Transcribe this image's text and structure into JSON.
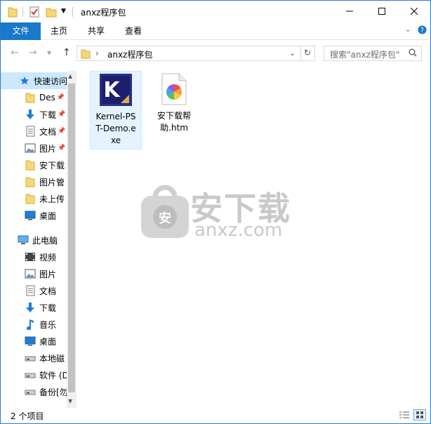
{
  "window": {
    "title": "anxz程序包",
    "colors": {
      "accent": "#1979ca",
      "selection": "#cce8ff",
      "border": "#2b79d6"
    }
  },
  "ribbon": {
    "tabs": [
      "文件",
      "主页",
      "共享",
      "查看"
    ]
  },
  "address": {
    "path": "anxz程序包",
    "search_placeholder": "搜索\"anxz程序包\""
  },
  "nav": {
    "quick_access": "快速访问",
    "quick_items": [
      {
        "label": "Des",
        "icon": "folder-icon",
        "pinned": true
      },
      {
        "label": "下载",
        "icon": "download-icon",
        "pinned": true
      },
      {
        "label": "文档",
        "icon": "document-icon",
        "pinned": true
      },
      {
        "label": "图片",
        "icon": "picture-icon",
        "pinned": true
      },
      {
        "label": "安下载",
        "icon": "folder-icon",
        "pinned": false
      },
      {
        "label": "图片管",
        "icon": "folder-icon",
        "pinned": false
      },
      {
        "label": "未上传",
        "icon": "folder-icon",
        "pinned": false
      },
      {
        "label": "桌面",
        "icon": "desktop-icon",
        "pinned": false
      }
    ],
    "this_pc": "此电脑",
    "pc_items": [
      {
        "label": "视频",
        "icon": "video-icon"
      },
      {
        "label": "图片",
        "icon": "picture-icon"
      },
      {
        "label": "文档",
        "icon": "document-icon"
      },
      {
        "label": "下载",
        "icon": "download-icon"
      },
      {
        "label": "音乐",
        "icon": "music-icon"
      },
      {
        "label": "桌面",
        "icon": "desktop-icon"
      },
      {
        "label": "本地磁",
        "icon": "drive-icon"
      },
      {
        "label": "软件 (D",
        "icon": "drive-icon"
      },
      {
        "label": "备份[勿",
        "icon": "drive-icon"
      }
    ]
  },
  "files": [
    {
      "name": "Kernel-PST-Demo.exe",
      "line1": "Kernel-PS",
      "line2": "T-Demo.e",
      "line3": "xe",
      "icon": "kernel-app-icon",
      "selected": true
    },
    {
      "name": "安下载帮助.htm",
      "line1": "安下载帮",
      "line2": "助.htm",
      "line3": "",
      "icon": "htm-file-icon",
      "selected": false
    }
  ],
  "watermark": {
    "cn": "安下载",
    "en": "anxz.com",
    "badge": "安"
  },
  "status": {
    "count": "2 个项目"
  }
}
